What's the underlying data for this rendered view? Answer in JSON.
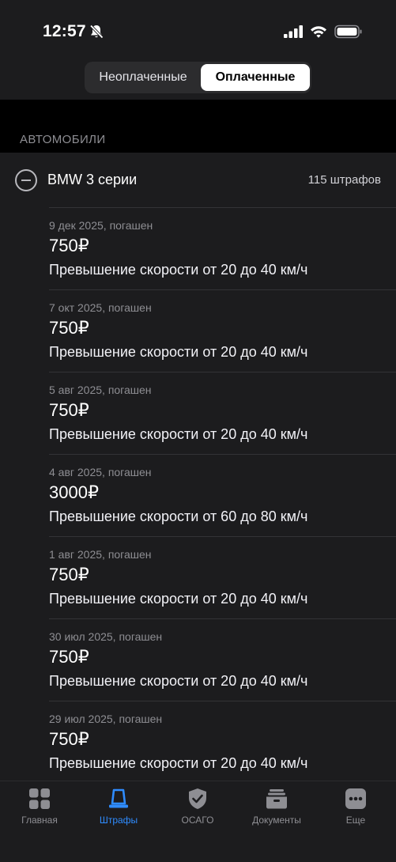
{
  "status_bar": {
    "time": "12:57"
  },
  "segment": {
    "unpaid": "Неоплаченные",
    "paid": "Оплаченные"
  },
  "section": {
    "title": "АВТОМОБИЛИ"
  },
  "car": {
    "name": "BMW 3 серии",
    "count": "115 штрафов"
  },
  "fines": [
    {
      "date": "9 дек 2025, погашен",
      "amount": "750₽",
      "desc": "Превышение скорости от 20 до 40 км/ч"
    },
    {
      "date": "7 окт 2025, погашен",
      "amount": "750₽",
      "desc": "Превышение скорости от 20 до 40 км/ч"
    },
    {
      "date": "5 авг 2025, погашен",
      "amount": "750₽",
      "desc": "Превышение скорости от 20 до 40 км/ч"
    },
    {
      "date": "4 авг 2025, погашен",
      "amount": "3000₽",
      "desc": "Превышение скорости от 60 до 80 км/ч"
    },
    {
      "date": "1 авг 2025, погашен",
      "amount": "750₽",
      "desc": "Превышение скорости от 20 до 40 км/ч"
    },
    {
      "date": "30 июл 2025, погашен",
      "amount": "750₽",
      "desc": "Превышение скорости от 20 до 40 км/ч"
    },
    {
      "date": "29 июл 2025, погашен",
      "amount": "750₽",
      "desc": "Превышение скорости от 20 до 40 км/ч"
    }
  ],
  "tabs": [
    {
      "label": "Главная",
      "icon": "grid-icon"
    },
    {
      "label": "Штрафы",
      "icon": "police-light-icon",
      "active": true
    },
    {
      "label": "ОСАГО",
      "icon": "shield-check-icon"
    },
    {
      "label": "Документы",
      "icon": "documents-tray-icon"
    },
    {
      "label": "Еще",
      "icon": "more-dots-icon"
    }
  ],
  "colors": {
    "accent": "#2f8cff",
    "background": "#1c1c1e",
    "secondary_text": "#8e8e93"
  }
}
